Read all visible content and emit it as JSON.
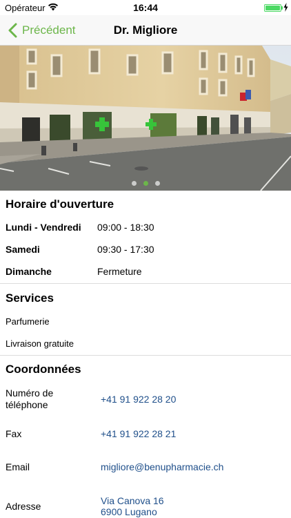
{
  "status_bar": {
    "carrier": "Opérateur",
    "time": "16:44",
    "battery_percent": 100
  },
  "nav": {
    "back_label": "Précédent",
    "title": "Dr. Migliore"
  },
  "carousel": {
    "page_count": 3,
    "active_page": 2
  },
  "hours": {
    "title": "Horaire d'ouverture",
    "rows": [
      {
        "day": "Lundi  - Vendredi",
        "time": "09:00 - 18:30"
      },
      {
        "day": "Samedi",
        "time": "09:30 - 17:30"
      },
      {
        "day": "Dimanche",
        "time": "Fermeture"
      }
    ]
  },
  "services": {
    "title": "Services",
    "items": [
      "Parfumerie",
      "Livraison gratuite"
    ]
  },
  "contact": {
    "title": "Coordonnées",
    "phone_label": "Numéro de téléphone",
    "phone": "+41 91 922 28 20",
    "fax_label": "Fax",
    "fax": "+41 91 922 28 21",
    "email_label": "Email",
    "email": "migliore@benupharmacie.ch",
    "address_label": "Adresse",
    "address_line1": "Via Canova 16",
    "address_line2": "6900 Lugano"
  },
  "colors": {
    "accent": "#6cb64a",
    "link": "#1f4f8a",
    "battery": "#4cd964"
  }
}
